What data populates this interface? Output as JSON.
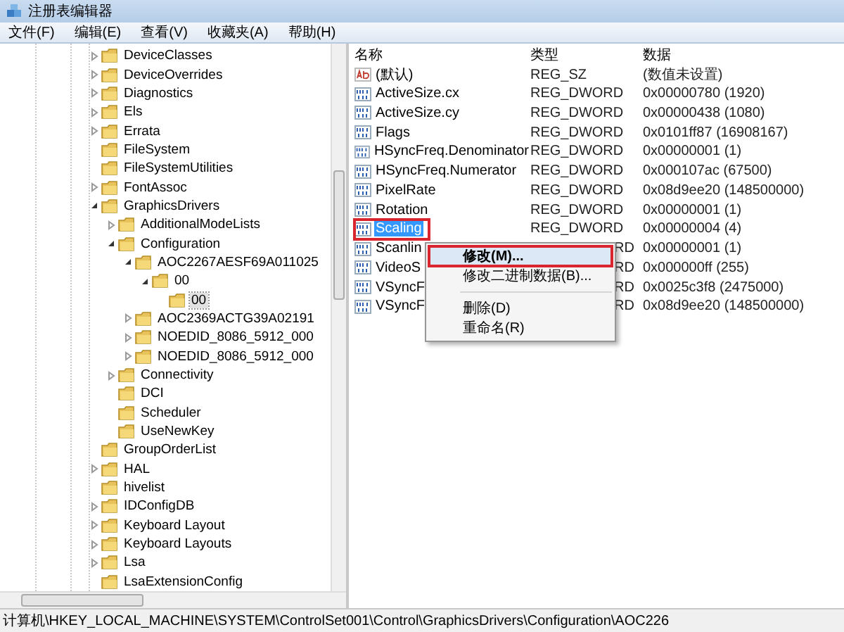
{
  "window": {
    "title": "注册表编辑器"
  },
  "menu": [
    "文件(F)",
    "编辑(E)",
    "查看(V)",
    "收藏夹(A)",
    "帮助(H)"
  ],
  "tree": [
    {
      "label": "DeviceClasses",
      "kind": "branch",
      "expanded": false,
      "selected": false
    },
    {
      "label": "DeviceOverrides",
      "kind": "branch",
      "expanded": false,
      "selected": false
    },
    {
      "label": "Diagnostics",
      "kind": "branch",
      "expanded": false,
      "selected": false
    },
    {
      "label": "Els",
      "kind": "branch",
      "expanded": false,
      "selected": false
    },
    {
      "label": "Errata",
      "kind": "branch",
      "expanded": false,
      "selected": false
    },
    {
      "label": "FileSystem",
      "kind": "leaf",
      "selected": false
    },
    {
      "label": "FileSystemUtilities",
      "kind": "leaf",
      "selected": false
    },
    {
      "label": "FontAssoc",
      "kind": "branch",
      "expanded": false,
      "selected": false
    },
    {
      "label": "GraphicsDrivers",
      "kind": "branch",
      "expanded": true,
      "selected": false,
      "children": [
        {
          "label": "AdditionalModeLists",
          "kind": "branch",
          "expanded": false,
          "selected": false
        },
        {
          "label": "Configuration",
          "kind": "branch",
          "expanded": true,
          "selected": false,
          "children": [
            {
              "label": "AOC2267AESF69A011025",
              "kind": "branch",
              "expanded": true,
              "selected": false,
              "children": [
                {
                  "label": "00",
                  "kind": "branch",
                  "expanded": true,
                  "selected": false,
                  "children": [
                    {
                      "label": "00",
                      "kind": "leaf",
                      "selected": true
                    }
                  ]
                }
              ]
            },
            {
              "label": "AOC2369ACTG39A02191",
              "kind": "branch",
              "expanded": false,
              "selected": false
            },
            {
              "label": "NOEDID_8086_5912_000",
              "kind": "branch",
              "expanded": false,
              "selected": false
            },
            {
              "label": "NOEDID_8086_5912_000",
              "kind": "branch",
              "expanded": false,
              "selected": false
            }
          ]
        },
        {
          "label": "Connectivity",
          "kind": "branch",
          "expanded": false,
          "selected": false
        },
        {
          "label": "DCI",
          "kind": "leaf",
          "selected": false
        },
        {
          "label": "Scheduler",
          "kind": "leaf",
          "selected": false
        },
        {
          "label": "UseNewKey",
          "kind": "leaf",
          "selected": false
        }
      ]
    },
    {
      "label": "GroupOrderList",
      "kind": "leaf",
      "selected": false
    },
    {
      "label": "HAL",
      "kind": "branch",
      "expanded": false,
      "selected": false
    },
    {
      "label": "hivelist",
      "kind": "leaf",
      "selected": false
    },
    {
      "label": "IDConfigDB",
      "kind": "branch",
      "expanded": false,
      "selected": false
    },
    {
      "label": "Keyboard Layout",
      "kind": "branch",
      "expanded": false,
      "selected": false
    },
    {
      "label": "Keyboard Layouts",
      "kind": "branch",
      "expanded": false,
      "selected": false
    },
    {
      "label": "Lsa",
      "kind": "branch",
      "expanded": false,
      "selected": false
    },
    {
      "label": "LsaExtensionConfig",
      "kind": "leaf",
      "selected": false
    }
  ],
  "table": {
    "columns": [
      "名称",
      "类型",
      "数据"
    ],
    "rows": [
      {
        "kind": "string",
        "name": "(默认)",
        "type": "REG_SZ",
        "data": "(数值未设置)",
        "selected": false,
        "annotated": false,
        "covered": false
      },
      {
        "kind": "dword",
        "name": "ActiveSize.cx",
        "type": "REG_DWORD",
        "data": "0x00000780 (1920)",
        "selected": false,
        "annotated": false,
        "covered": false
      },
      {
        "kind": "dword",
        "name": "ActiveSize.cy",
        "type": "REG_DWORD",
        "data": "0x00000438 (1080)",
        "selected": false,
        "annotated": false,
        "covered": false
      },
      {
        "kind": "dword",
        "name": "Flags",
        "type": "REG_DWORD",
        "data": "0x0101ff87 (16908167)",
        "selected": false,
        "annotated": false,
        "covered": false
      },
      {
        "kind": "dword",
        "name": "HSyncFreq.Denominator",
        "type": "REG_DWORD",
        "data": "0x00000001 (1)",
        "selected": false,
        "annotated": false,
        "covered": false
      },
      {
        "kind": "dword",
        "name": "HSyncFreq.Numerator",
        "type": "REG_DWORD",
        "data": "0x000107ac (67500)",
        "selected": false,
        "annotated": false,
        "covered": false
      },
      {
        "kind": "dword",
        "name": "PixelRate",
        "type": "REG_DWORD",
        "data": "0x08d9ee20 (148500000)",
        "selected": false,
        "annotated": false,
        "covered": false
      },
      {
        "kind": "dword",
        "name": "Rotation",
        "type": "REG_DWORD",
        "data": "0x00000001 (1)",
        "selected": false,
        "annotated": false,
        "covered": false
      },
      {
        "kind": "dword",
        "name": "Scaling",
        "type": "REG_DWORD",
        "data": "0x00000004 (4)",
        "selected": true,
        "annotated": true,
        "covered": false
      },
      {
        "kind": "dword",
        "name": "Scanlin",
        "type": "RD",
        "data": "0x00000001 (1)",
        "selected": false,
        "annotated": false,
        "covered": true
      },
      {
        "kind": "dword",
        "name": "VideoS",
        "type": "RD",
        "data": "0x000000ff (255)",
        "selected": false,
        "annotated": false,
        "covered": true
      },
      {
        "kind": "dword",
        "name": "VSyncF",
        "type": "RD",
        "data": "0x0025c3f8 (2475000)",
        "selected": false,
        "annotated": false,
        "covered": true
      },
      {
        "kind": "dword",
        "name": "VSyncF",
        "type": "RD",
        "data": "0x08d9ee20 (148500000)",
        "selected": false,
        "annotated": false,
        "covered": true
      }
    ]
  },
  "context_menu": [
    {
      "kind": "item",
      "label": "修改(M)...",
      "highlighted": true,
      "annotated": true
    },
    {
      "kind": "item",
      "label": "修改二进制数据(B)...",
      "highlighted": false,
      "annotated": false
    },
    {
      "kind": "separator"
    },
    {
      "kind": "item",
      "label": "删除(D)",
      "highlighted": false,
      "annotated": false
    },
    {
      "kind": "item",
      "label": "重命名(R)",
      "highlighted": false,
      "annotated": false
    }
  ],
  "status_bar": "计算机\\HKEY_LOCAL_MACHINE\\SYSTEM\\ControlSet001\\Control\\GraphicsDrivers\\Configuration\\AOC226"
}
